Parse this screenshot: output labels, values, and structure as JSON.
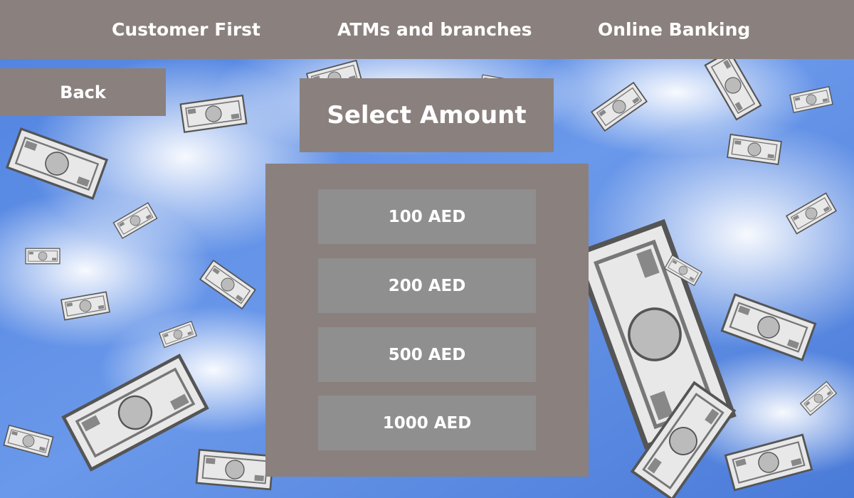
{
  "nav": {
    "items": [
      {
        "label": "Customer First"
      },
      {
        "label": "ATMs and branches"
      },
      {
        "label": "Online Banking"
      }
    ]
  },
  "back": {
    "label": "Back"
  },
  "title": "Select Amount",
  "amounts": [
    {
      "label": "100 AED"
    },
    {
      "label": "200 AED"
    },
    {
      "label": "500 AED"
    },
    {
      "label": "1000 AED"
    }
  ],
  "colors": {
    "bar_background": "#8a807e",
    "button_background": "#8f8f8f",
    "text": "#ffffff",
    "sky": "#5b8ae0"
  },
  "background": {
    "icon": "falling-dollar-bills-image"
  }
}
